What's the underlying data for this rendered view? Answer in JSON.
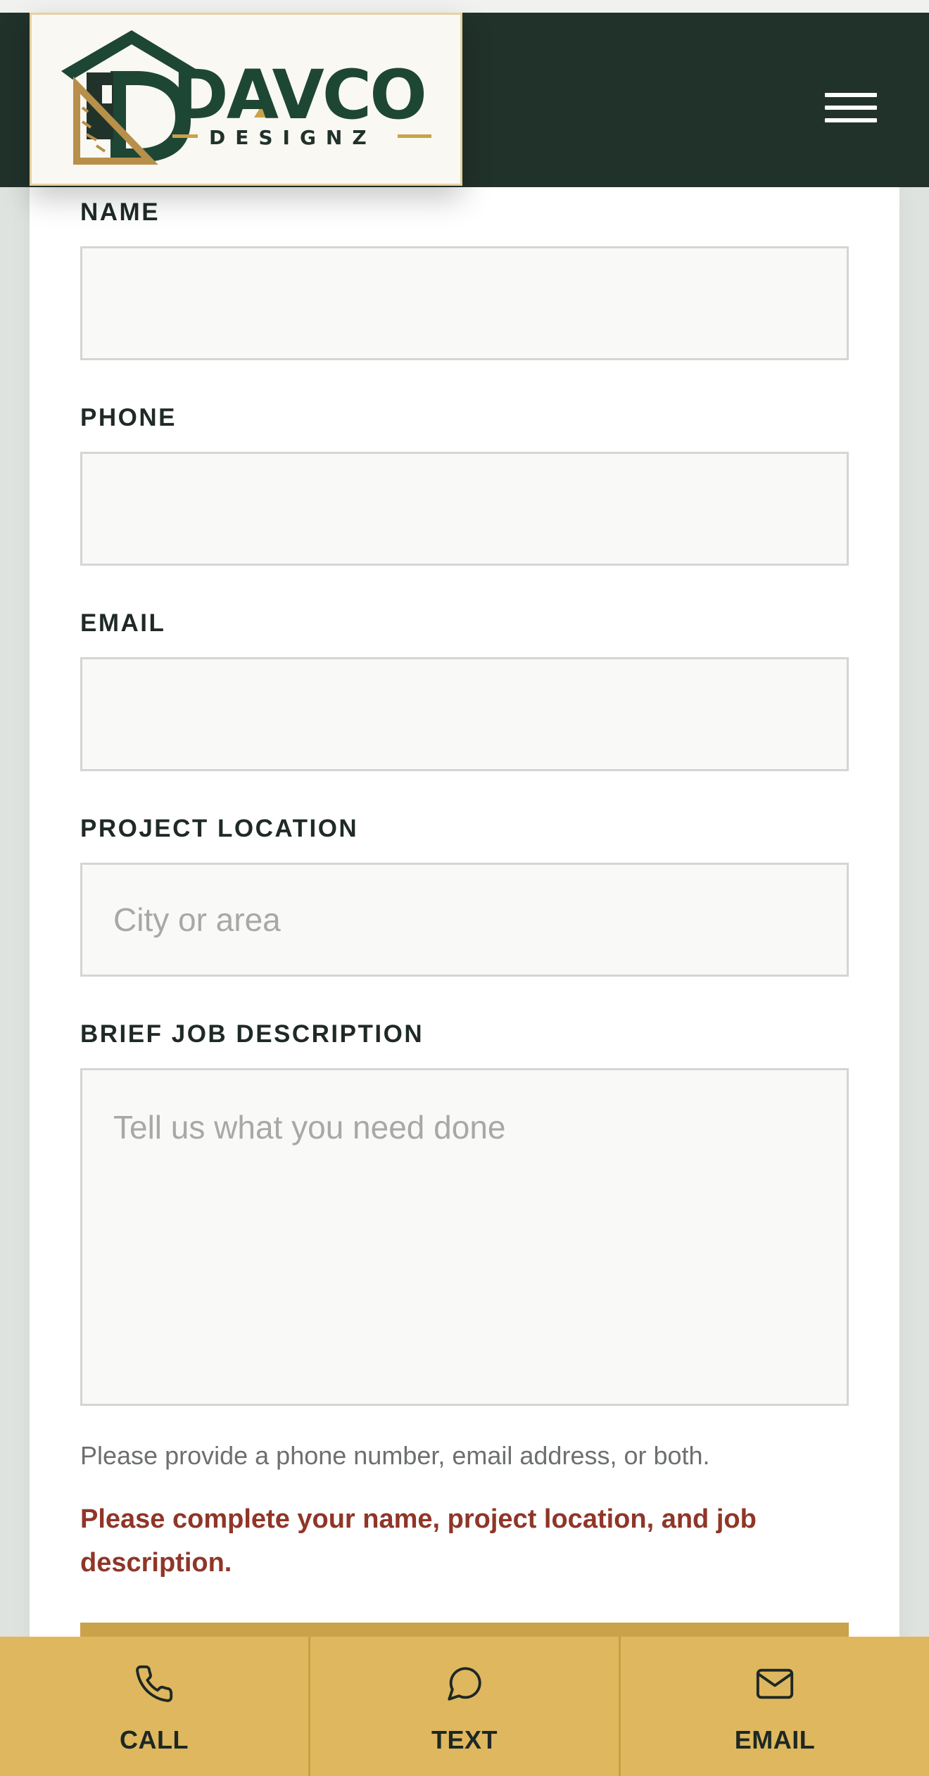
{
  "brand": {
    "name": "DAVCO",
    "tagline": "DESIGNZ"
  },
  "colors": {
    "header_bg": "#21322b",
    "brand_green": "#1e4634",
    "brand_gold": "#c9a24a",
    "bottom_bar_bg": "#dfb75e",
    "error_text": "#8f3628"
  },
  "header": {
    "menu_icon": "hamburger-menu-icon"
  },
  "form": {
    "fields": [
      {
        "label": "NAME",
        "value": "",
        "placeholder": ""
      },
      {
        "label": "PHONE",
        "value": "",
        "placeholder": ""
      },
      {
        "label": "EMAIL",
        "value": "",
        "placeholder": ""
      },
      {
        "label": "PROJECT LOCATION",
        "value": "",
        "placeholder": "City or area"
      },
      {
        "label": "BRIEF JOB DESCRIPTION",
        "value": "",
        "placeholder": "Tell us what you need done"
      }
    ],
    "helper_text": "Please provide a phone number, email address, or both.",
    "error_text": "Please complete your name, project location, and job description."
  },
  "bottom_bar": {
    "items": [
      {
        "label": "CALL",
        "icon": "phone-icon"
      },
      {
        "label": "TEXT",
        "icon": "chat-bubble-icon"
      },
      {
        "label": "EMAIL",
        "icon": "mail-icon"
      }
    ]
  }
}
